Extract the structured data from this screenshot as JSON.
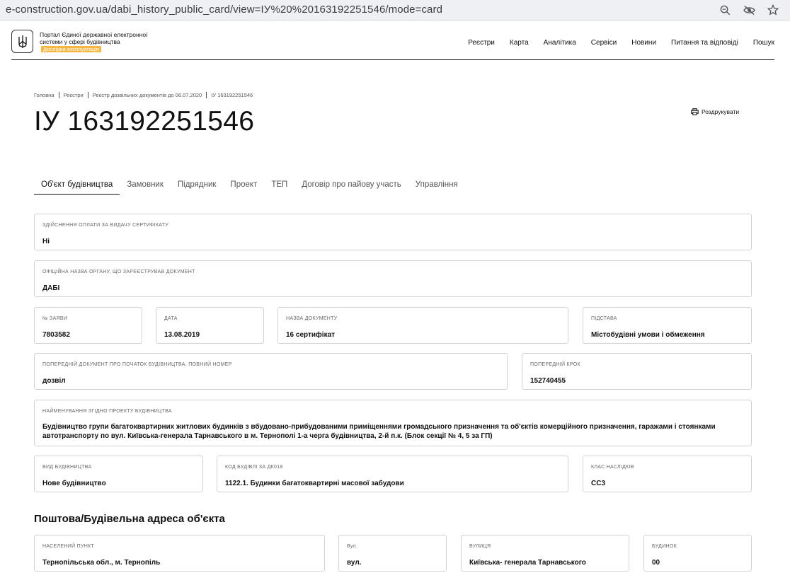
{
  "browser": {
    "url": "e-construction.gov.ua/dabi_history_public_card/view=ІУ%20%20163192251546/mode=card",
    "icons": [
      "zoom-icon",
      "eye-off-icon",
      "star-icon"
    ]
  },
  "header": {
    "portal_title": "Портал Єдиної державної електронної системи у сфері будівництва",
    "badge": "Дослідна експлуатація",
    "nav": [
      "Реєстри",
      "Карта",
      "Аналітика",
      "Сервіси",
      "Новини",
      "Питання та відповіді",
      "Пошук"
    ]
  },
  "breadcrumb": [
    "Головна",
    "Реєстри",
    "Реєстр дозвільних документів до 06.07.2020",
    "ІУ 163192251546"
  ],
  "page_title": "ІУ 163192251546",
  "print_label": "Роздрукувати",
  "tabs": [
    "Об'єкт будівництва",
    "Замовник",
    "Підрядник",
    "Проект",
    "ТЕП",
    "Договір про пайову участь",
    "Управління"
  ],
  "active_tab": "Об'єкт будівництва",
  "fields": {
    "payment": {
      "label": "Здійснення оплати за видачу сертифікату",
      "value": "Ні"
    },
    "org_name": {
      "label": "Офіційна назва органу, що зареєстрував документ",
      "value": "ДАБІ"
    },
    "app_no": {
      "label": "№ заяви",
      "value": "7803582"
    },
    "date": {
      "label": "Дата",
      "value": "13.08.2019"
    },
    "doc_name": {
      "label": "Назва документу",
      "value": "16 сертифікат"
    },
    "basis": {
      "label": "Підстава",
      "value": "Містобудівні умови і обмеження"
    },
    "prev_doc": {
      "label": "Попередній документ про початок будівництва, повний номер",
      "value": "дозвіл"
    },
    "prev_step": {
      "label": "Попередній крок",
      "value": "152740455"
    },
    "project_name": {
      "label": "Найменування згідно проекту будівництва",
      "value": "Будівництво групи багатоквартирних житлових будинків з вбудовано-прибудованими приміщеннями громадського призначення та об'єктів комерційного призначення, гаражами і стоянками автотранспорту по вул. Київська-генерала Тарнавського в м. Тернополі 1-а черга будівництва, 2-й п.к. (Блок секції № 4, 5 за ГП)"
    },
    "build_type": {
      "label": "Вид будівництва",
      "value": "Нове будівництво"
    },
    "building_code": {
      "label": "Код будівлі за ДК018",
      "value": "1122.1. Будинки багатоквартирні масової забудови"
    },
    "consequence_class": {
      "label": "Клас наслідків",
      "value": "СС3"
    }
  },
  "address_section_title": "Поштова/Будівельна адреса об'єкта",
  "address": {
    "locality": {
      "label": "Населений пункт",
      "value": "Тернопільська обл., м. Тернопіль"
    },
    "street_type": {
      "label": "Вул.",
      "value": "вул."
    },
    "street": {
      "label": "Вулиця",
      "value": "Київська- генерала Тарнавського"
    },
    "building": {
      "label": "Будинок",
      "value": "00"
    }
  }
}
